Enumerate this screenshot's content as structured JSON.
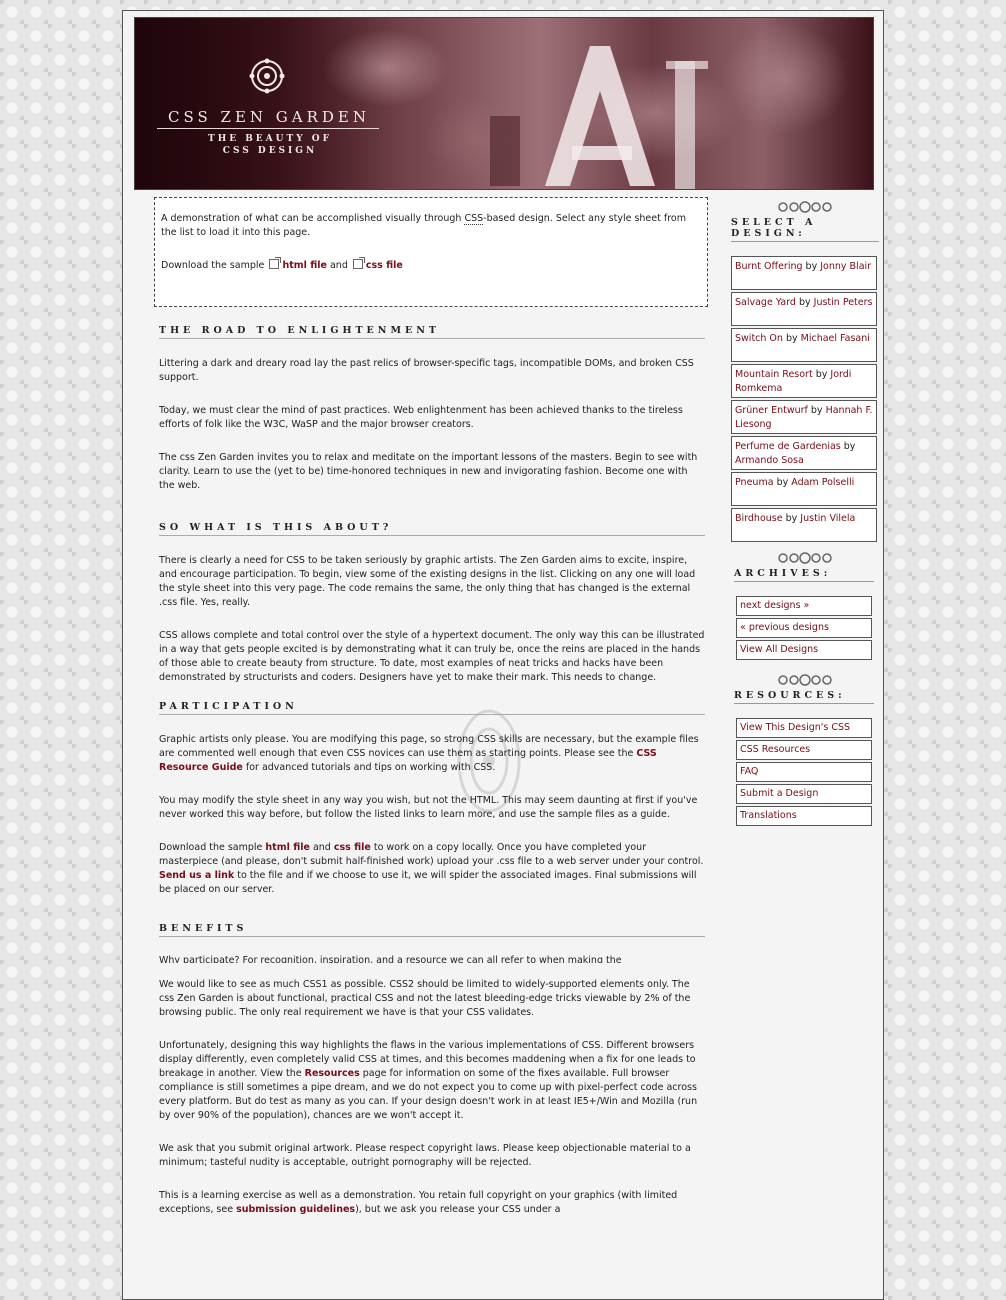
{
  "header": {
    "title": "CSS ZEN GARDEN",
    "tagline": "THE BEAUTY OF CSS DESIGN"
  },
  "intro": {
    "text_before": "A demonstration of what can be accomplished visually through ",
    "css_abbr": "CSS",
    "text_after": "-based design. Select any style sheet from the list to load it into this page.",
    "download_prefix": "Download the sample",
    "html_link": "html file",
    "and": "and",
    "css_link": "css file"
  },
  "sections": {
    "road": {
      "heading": "THE ROAD TO ENLIGHTENMENT",
      "p1": "Littering a dark and dreary road lay the past relics of browser-specific tags, incompatible DOMs, and broken CSS support.",
      "p2": "Today, we must clear the mind of past practices. Web enlightenment has been achieved thanks to the tireless efforts of folk like the W3C, WaSP and the major browser creators.",
      "p3": "The css Zen Garden invites you to relax and meditate on the important lessons of the masters. Begin to see with clarity. Learn to use the (yet to be) time-honored techniques in new and invigorating fashion. Become one with the web."
    },
    "about": {
      "heading": "SO WHAT IS THIS ABOUT?",
      "p1": "There is clearly a need for CSS to be taken seriously by graphic artists. The Zen Garden aims to excite, inspire, and encourage participation. To begin, view some of the existing designs in the list. Clicking on any one will load the style sheet into this very page. The code remains the same, the only thing that has changed is the external .css file. Yes, really.",
      "p2": "CSS allows complete and total control over the style of a hypertext document. The only way this can be illustrated in a way that gets people excited is by demonstrating what it can truly be, once the reins are placed in the hands of those able to create beauty from structure. To date, most examples of neat tricks and hacks have been demonstrated by structurists and coders. Designers have yet to make their mark. This needs to change."
    },
    "participation": {
      "heading": "PARTICIPATION",
      "p1a": "Graphic artists only please. You are modifying this page, so strong CSS skills are necessary, but the example files are commented well enough that even CSS novices can use them as starting points. Please see the ",
      "p1_link": "CSS Resource Guide",
      "p1b": " for advanced tutorials and tips on working with CSS.",
      "p2": "You may modify the style sheet in any way you wish, but not the HTML. This may seem daunting at first if you've never worked this way before, but follow the listed links to learn more, and use the sample files as a guide.",
      "p3a": "Download the sample ",
      "p3_html": "html file",
      "p3_and": " and ",
      "p3_css": "css file",
      "p3b": " to work on a copy locally. Once you have completed your masterpiece (and please, don't submit half-finished work) upload your .css file to a web server under your control. ",
      "p3_send": "Send us a link",
      "p3c": " to the file and if we choose to use it, we will spider the associated images. Final submissions will be placed on our server."
    },
    "benefits": {
      "heading": "BENEFITS",
      "p1": "Why participate? For recognition, inspiration, and a resource we can all refer to when making the",
      "p2": "We would like to see as much CSS1 as possible. CSS2 should be limited to widely-supported elements only. The css Zen Garden is about functional, practical CSS and not the latest bleeding-edge tricks viewable by 2% of the browsing public. The only real requirement we have is that your CSS validates.",
      "p3a": "Unfortunately, designing this way highlights the flaws in the various implementations of CSS. Different browsers display differently, even completely valid CSS at times, and this becomes maddening when a fix for one leads to breakage in another. View the ",
      "p3_link": "Resources",
      "p3b": " page for information on some of the fixes available. Full browser compliance is still sometimes a pipe dream, and we do not expect you to come up with pixel-perfect code across every platform. But do test as many as you can. If your design doesn't work in at least IE5+/Win and Mozilla (run by over 90% of the population), chances are we won't accept it.",
      "p4": "We ask that you submit original artwork. Please respect copyright laws. Please keep objectionable material to a minimum; tasteful nudity is acceptable, outright pornography will be rejected.",
      "p5a": "This is a learning exercise as well as a demonstration. You retain full copyright on your graphics (with limited exceptions, see ",
      "p5_link": "submission guidelines",
      "p5b": "), but we ask you release your CSS under a"
    }
  },
  "sidebar": {
    "select_heading": "SELECT A DESIGN:",
    "designs": [
      {
        "name": "Burnt Offering",
        "by": "by",
        "author": "Jonny Blair"
      },
      {
        "name": "Salvage Yard",
        "by": "by",
        "author": "Justin Peters"
      },
      {
        "name": "Switch On",
        "by": "by",
        "author": "Michael Fasani"
      },
      {
        "name": "Mountain Resort",
        "by": "by",
        "author": "Jordi Romkema"
      },
      {
        "name": "Grüner Entwurf",
        "by": "by",
        "author": "Hannah F. Liesong"
      },
      {
        "name": "Perfume de Gardenias",
        "by": "by",
        "author": "Armando Sosa"
      },
      {
        "name": "Pneuma",
        "by": "by",
        "author": "Adam Polselli"
      },
      {
        "name": "Birdhouse",
        "by": "by",
        "author": "Justin Vilela"
      }
    ],
    "archives_heading": "ARCHIVES:",
    "archives": [
      "next designs »",
      "« previous designs",
      "View All Designs"
    ],
    "resources_heading": "RESOURCES:",
    "resources": [
      "View This Design's CSS",
      "CSS Resources",
      "FAQ",
      "Submit a Design",
      "Translations"
    ]
  },
  "colors": {
    "link": "#7a0c18",
    "page_bg": "#f4f4f4",
    "header_dark": "#2a0b10"
  },
  "icons": [
    "ornament-icon",
    "external-link-icon"
  ]
}
